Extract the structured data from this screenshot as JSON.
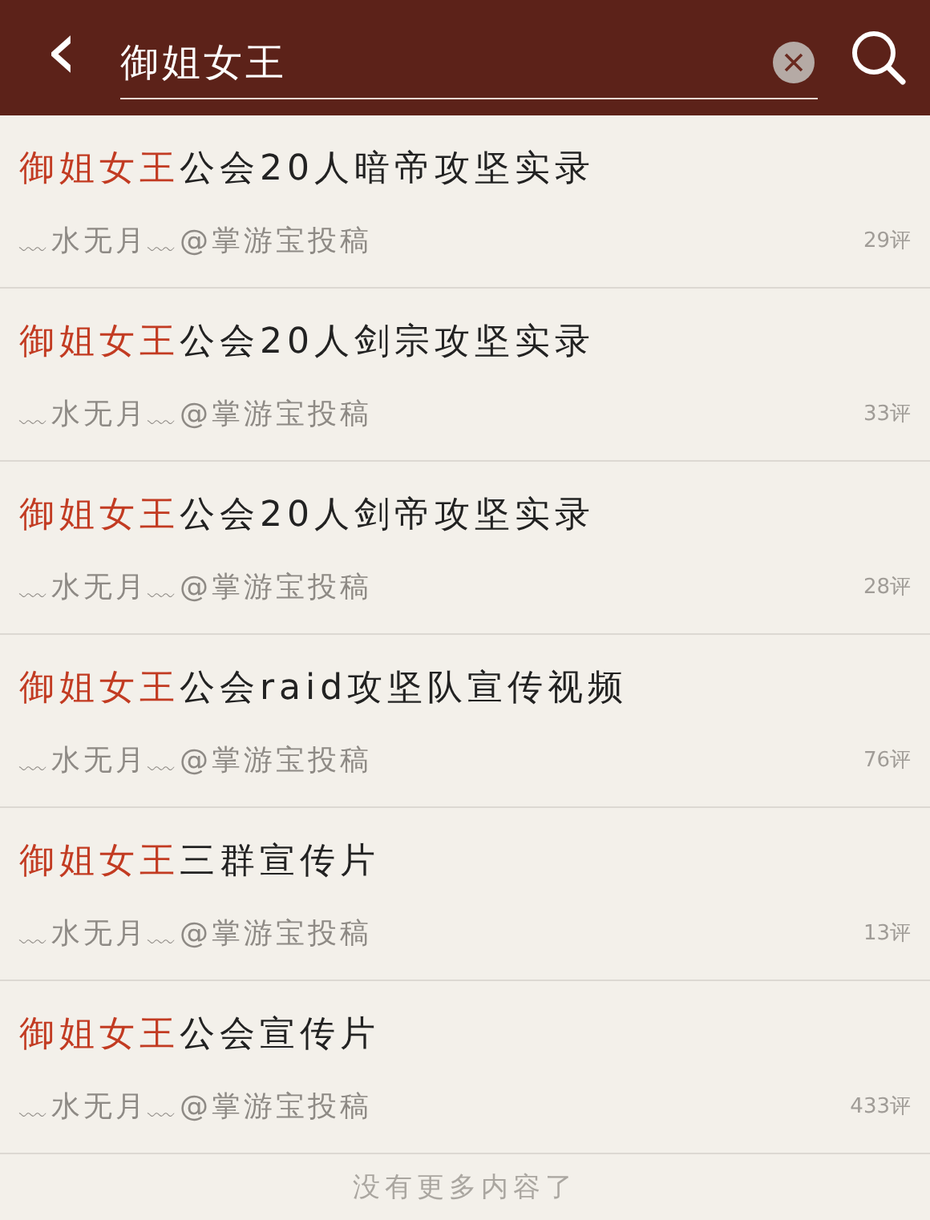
{
  "search_bar": {
    "back": "‹",
    "value": "御姐女王"
  },
  "results": [
    {
      "match": "御姐女王",
      "rest": "公会20人暗帝攻坚实录",
      "source": "﹏水无月﹏@掌游宝投稿",
      "comments": "29评"
    },
    {
      "match": "御姐女王",
      "rest": "公会20人剑宗攻坚实录",
      "source": "﹏水无月﹏@掌游宝投稿",
      "comments": "33评"
    },
    {
      "match": "御姐女王",
      "rest": "公会20人剑帝攻坚实录",
      "source": "﹏水无月﹏@掌游宝投稿",
      "comments": "28评"
    },
    {
      "match": "御姐女王",
      "rest": "公会raid攻坚队宣传视频",
      "source": "﹏水无月﹏@掌游宝投稿",
      "comments": "76评"
    },
    {
      "match": "御姐女王",
      "rest": "三群宣传片",
      "source": "﹏水无月﹏@掌游宝投稿",
      "comments": "13评"
    },
    {
      "match": "御姐女王",
      "rest": "公会宣传片",
      "source": "﹏水无月﹏@掌游宝投稿",
      "comments": "433评"
    }
  ],
  "footer": "没有更多内容了"
}
